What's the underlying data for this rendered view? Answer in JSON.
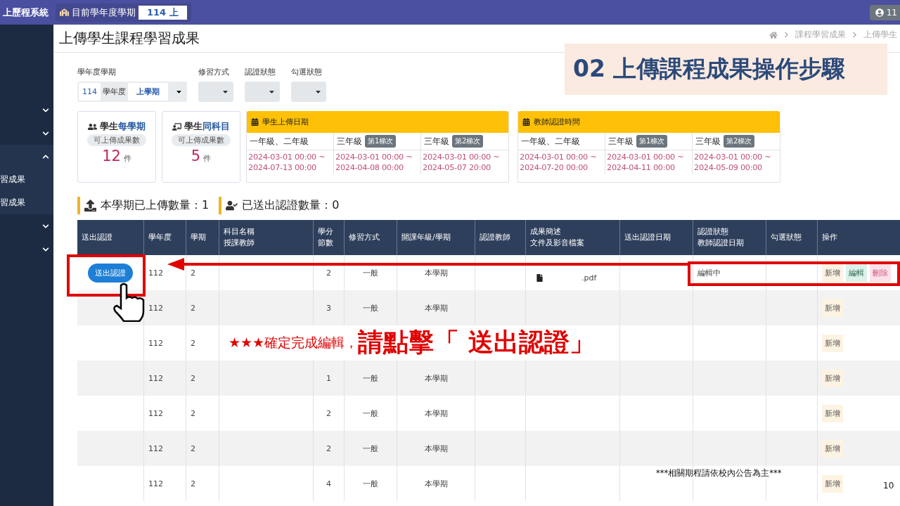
{
  "topbar": {
    "system_name": "上歷程系統",
    "term_label": "目前學年度學期",
    "term_value": "114 上",
    "user": "11"
  },
  "sidebar": {
    "groups": [
      {
        "expanded": false
      },
      {
        "expanded": false
      },
      {
        "expanded": true,
        "children": [
          {
            "label": "習成果"
          },
          {
            "label": "習成果"
          }
        ]
      },
      {
        "expanded": false
      },
      {
        "expanded": false
      }
    ]
  },
  "page_title": "上傳學生課程學習成果",
  "breadcrumb": [
    "課程學習成果",
    "上傳學生"
  ],
  "filters": {
    "term": {
      "label": "學年度學期",
      "year": "114",
      "year_unit": "學年度",
      "semester": "上學期"
    },
    "selects": [
      {
        "label": "修習方式"
      },
      {
        "label": "認證狀態"
      },
      {
        "label": "勾選狀態"
      }
    ]
  },
  "stat_cards": [
    {
      "kind": "people",
      "title": "學生",
      "highlight": "每學期",
      "pill": "可上傳成果數",
      "value": "12",
      "unit": "件"
    },
    {
      "kind": "teacher",
      "title": "學生",
      "highlight": "同科目",
      "pill": "可上傳成果數",
      "value": "5",
      "unit": "件"
    }
  ],
  "date_tables": [
    {
      "title": "學生上傳日期",
      "columns": [
        {
          "grade": "一年級、二年級",
          "start": "2024-03-01 00:00 ~",
          "end": "2024-07-13 00:00"
        },
        {
          "grade": "三年級",
          "badge": "第1梯次",
          "start": "2024-03-01 00:00 ~",
          "end": "2024-04-08 00:00"
        },
        {
          "grade": "三年級",
          "badge": "第2梯次",
          "start": "2024-03-01 00:00 ~",
          "end": "2024-05-07 20:00"
        }
      ]
    },
    {
      "title": "教師認證時間",
      "columns": [
        {
          "grade": "一年級、二年級",
          "start": "2024-03-01 00:00 ~",
          "end": "2024-07-20 00:00"
        },
        {
          "grade": "三年級",
          "badge": "第1梯次",
          "start": "2024-03-01 00:00 ~",
          "end": "2024-04-11 00:00"
        },
        {
          "grade": "三年級",
          "badge": "第2梯次",
          "start": "2024-03-01 00:00 ~",
          "end": "2024-05-09 00:00"
        }
      ]
    }
  ],
  "counters": [
    {
      "kind": "upload",
      "text": "本學期已上傳數量：1"
    },
    {
      "kind": "sent",
      "text": "已送出認證數量：0"
    }
  ],
  "table": {
    "columns": [
      [
        "送出認證"
      ],
      [
        "學年度"
      ],
      [
        "學期"
      ],
      [
        "科目名稱",
        "授課教師"
      ],
      [
        "學分",
        "節數"
      ],
      [
        "修習方式"
      ],
      [
        "開課年級/學期"
      ],
      [
        "認證教師"
      ],
      [
        "成果簡述",
        "文件及影音檔案"
      ],
      [
        "送出認證日期"
      ],
      [
        "認證狀態",
        "教師認證日期"
      ],
      [
        "勾選狀態"
      ],
      [
        "操作"
      ]
    ],
    "rows": [
      {
        "send_button": "送出認證",
        "year": "112",
        "term": "2",
        "credits": "2",
        "method": "一般",
        "semester": "本學期",
        "file": ".pdf",
        "status": "編輯中",
        "actions": [
          {
            "kind": "add",
            "label": "新增"
          },
          {
            "kind": "edit",
            "label": "編輯"
          },
          {
            "kind": "delete",
            "label": "刪除"
          }
        ]
      },
      {
        "year": "112",
        "term": "2",
        "credits": "3",
        "method": "一般",
        "semester": "本學期",
        "actions": [
          {
            "kind": "add",
            "label": "新增"
          }
        ]
      },
      {
        "year": "112",
        "term": "2",
        "actions": [
          {
            "kind": "add",
            "label": "新增"
          }
        ]
      },
      {
        "year": "112",
        "term": "2",
        "credits": "1",
        "method": "一般",
        "semester": "本學期",
        "actions": [
          {
            "kind": "add",
            "label": "新增"
          }
        ]
      },
      {
        "year": "112",
        "term": "2",
        "credits": "2",
        "method": "一般",
        "semester": "本學期",
        "actions": [
          {
            "kind": "add",
            "label": "新增"
          }
        ]
      },
      {
        "year": "112",
        "term": "2",
        "credits": "2",
        "method": "一般",
        "semester": "本學期",
        "actions": [
          {
            "kind": "add",
            "label": "新增"
          }
        ]
      },
      {
        "year": "112",
        "term": "2",
        "credits": "4",
        "method": "一般",
        "semester": "本學期",
        "actions": [
          {
            "kind": "add",
            "label": "新增"
          }
        ]
      }
    ]
  },
  "slide": {
    "step_title": "02 上傳課程成果操作步驟",
    "hint_small": "★★★確定完成編輯，",
    "hint_large": "請點擊「 送出認證」",
    "footnote": "***相關期程請依校內公告為主***",
    "page_number": "10"
  }
}
